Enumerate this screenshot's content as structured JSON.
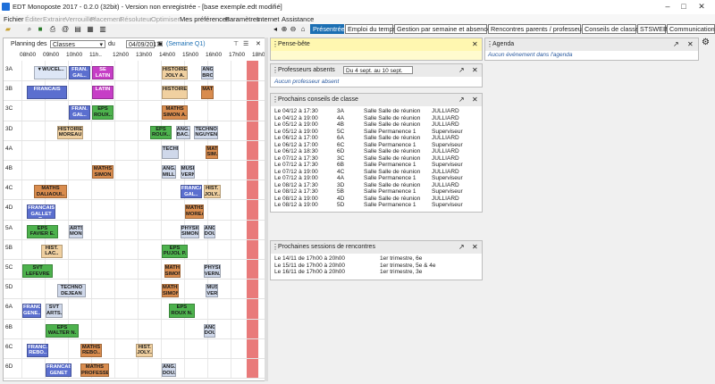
{
  "window": {
    "title": "EDT Monoposte 2017 - 0.2.0 (32bit) - Version non enregistrée - [base exemple.edt modifié]",
    "controls": [
      "–",
      "□",
      "✕"
    ]
  },
  "menu": [
    {
      "label": "Fichier",
      "dim": false
    },
    {
      "label": "Éditer",
      "dim": true
    },
    {
      "label": "Extraire",
      "dim": true
    },
    {
      "label": "Verrouiller",
      "dim": true
    },
    {
      "label": "Placement",
      "dim": true
    },
    {
      "label": "Résoluteur",
      "dim": true
    },
    {
      "label": "Optimiser",
      "dim": true
    },
    {
      "label": "Mes préférences",
      "dim": false
    },
    {
      "label": "Paramètres",
      "dim": false
    },
    {
      "label": "Internet",
      "dim": false
    },
    {
      "label": "Assistance",
      "dim": false
    }
  ],
  "tabs": [
    "Présentrée",
    "Emploi du temps",
    "Gestion par semaine et absences",
    "Rencontres parents / professeurs",
    "Conseils de classe",
    "STSWEB",
    "Communication"
  ],
  "planning": {
    "label_prefix": "Planning des",
    "select_value": "Classes",
    "du_label": "du",
    "date_value": "04/09/2017",
    "week_label": "(Semaine Q1)",
    "times": [
      "08h00",
      "09h00",
      "10h00",
      "11h..",
      "12h00",
      "13h00",
      "14h00",
      "15h00",
      "16h00",
      "17h00",
      "18h00"
    ],
    "rows": [
      "3A",
      "3B",
      "3C",
      "3D",
      "4A",
      "4B",
      "4C",
      "4D",
      "5A",
      "5B",
      "5C",
      "5D",
      "6A",
      "6B",
      "6C",
      "6D"
    ]
  },
  "schedule": [
    {
      "row": 0,
      "col": 0.5,
      "w": 1.5,
      "text": "▼WUCEL..",
      "color": "#dde6f6"
    },
    {
      "row": 0,
      "col": 3,
      "w": 1,
      "text": "SE LATIN",
      "color": "#c63ec6"
    },
    {
      "row": 0,
      "col": 2,
      "w": 1,
      "text": "FRAN. GAL..",
      "color": "#5b6fcf"
    },
    {
      "row": 0,
      "col": 6,
      "w": 1.2,
      "text": "HISTOIRE JOLY A.",
      "color": "#f0d0a0"
    },
    {
      "row": 0,
      "col": 7.7,
      "w": 0.6,
      "text": "ANG. BRO..",
      "color": "#cfd8ea"
    },
    {
      "row": 1,
      "col": 0.2,
      "w": 1.8,
      "text": "FRANCAIS",
      "color": "#5b6fcf"
    },
    {
      "row": 1,
      "col": 3,
      "w": 1,
      "text": "LATIN",
      "color": "#c63ec6"
    },
    {
      "row": 1,
      "col": 6,
      "w": 1.2,
      "text": "HISTOIRE-..",
      "color": "#f0d0a0"
    },
    {
      "row": 1,
      "col": 7.7,
      "w": 0.6,
      "text": "MATHS",
      "color": "#d98c4e"
    },
    {
      "row": 2,
      "col": 2,
      "w": 1,
      "text": "FRAN. GAL..",
      "color": "#5b6fcf"
    },
    {
      "row": 2,
      "col": 3,
      "w": 1,
      "text": "EPS ROUX..",
      "color": "#4db24d"
    },
    {
      "row": 2,
      "col": 6,
      "w": 1.2,
      "text": "MATHS SIMON A.",
      "color": "#d98c4e"
    },
    {
      "row": 3,
      "col": 1.5,
      "w": 1.2,
      "text": "HISTOIRE MOREAU C.",
      "color": "#f0d0a0"
    },
    {
      "row": 3,
      "col": 5.5,
      "w": 1,
      "text": "EPS ROUX..",
      "color": "#4db24d"
    },
    {
      "row": 3,
      "col": 6.6,
      "w": 0.7,
      "text": "ANG. BAC..",
      "color": "#cfd8ea"
    },
    {
      "row": 3,
      "col": 7.4,
      "w": 1.1,
      "text": "TECHNO NGUYEN S.",
      "color": "#cfd8ea"
    },
    {
      "row": 4,
      "col": 6,
      "w": 0.8,
      "text": "TECHNO",
      "color": "#cfd8ea"
    },
    {
      "row": 4,
      "col": 7.9,
      "w": 0.6,
      "text": "MATHS SIM..",
      "color": "#d98c4e"
    },
    {
      "row": 5,
      "col": 3,
      "w": 1,
      "text": "MATHS SIMON A.",
      "color": "#d98c4e"
    },
    {
      "row": 5,
      "col": 6,
      "w": 0.7,
      "text": "ANG. MILL..",
      "color": "#cfd8ea"
    },
    {
      "row": 5,
      "col": 6.8,
      "w": 0.7,
      "text": "MUSI.. VERN..",
      "color": "#cfd8ea"
    },
    {
      "row": 6,
      "col": 0.5,
      "w": 1.5,
      "text": "MATHS DALIAOUI..",
      "color": "#d98c4e"
    },
    {
      "row": 6,
      "col": 6.8,
      "w": 1,
      "text": "FRANCAIS GAL..",
      "color": "#5b6fcf"
    },
    {
      "row": 6,
      "col": 7.8,
      "w": 0.8,
      "text": "HIST. JOLY..",
      "color": "#f0d0a0"
    },
    {
      "row": 7,
      "col": 0.2,
      "w": 1.3,
      "text": "FRANCAIS GALLET B.",
      "color": "#5b6fcf"
    },
    {
      "row": 7,
      "col": 7,
      "w": 0.9,
      "text": "MATHS MOREAU..",
      "color": "#d98c4e"
    },
    {
      "row": 8,
      "col": 0.2,
      "w": 1.4,
      "text": "EPS FAVIER E.",
      "color": "#4db24d"
    },
    {
      "row": 8,
      "col": 2,
      "w": 0.7,
      "text": "ARTS. MONI..",
      "color": "#cfd8ea"
    },
    {
      "row": 8,
      "col": 6.8,
      "w": 0.9,
      "text": "PHYSIQUE.. SIMON T.",
      "color": "#cfd8ea"
    },
    {
      "row": 8,
      "col": 7.8,
      "w": 0.6,
      "text": "ANG. DOU..",
      "color": "#cfd8ea"
    },
    {
      "row": 9,
      "col": 0.8,
      "w": 1,
      "text": "HIST. LAC..",
      "color": "#f0d0a0"
    },
    {
      "row": 9,
      "col": 6,
      "w": 1.2,
      "text": "EPS PUJOL P.",
      "color": "#4db24d"
    },
    {
      "row": 10,
      "col": 0,
      "w": 1.4,
      "text": "SVT LEFEVRE A.",
      "color": "#4db24d"
    },
    {
      "row": 10,
      "col": 6.1,
      "w": 0.8,
      "text": "MATHS SIMON A.",
      "color": "#d98c4e"
    },
    {
      "row": 10,
      "col": 7.8,
      "w": 0.8,
      "text": "PHYSIQUE VERN..",
      "color": "#cfd8ea"
    },
    {
      "row": 11,
      "col": 1.5,
      "w": 1.3,
      "text": "TECHNO DEJEAN Y.",
      "color": "#cfd8ea"
    },
    {
      "row": 11,
      "col": 6,
      "w": 0.8,
      "text": "MATHS SIMON A.",
      "color": "#d98c4e"
    },
    {
      "row": 11,
      "col": 7.9,
      "w": 0.6,
      "text": "MUSI. VERN..",
      "color": "#cfd8ea"
    },
    {
      "row": 12,
      "col": 0,
      "w": 0.9,
      "text": "FRANC. GENE..",
      "color": "#5b6fcf"
    },
    {
      "row": 12,
      "col": 1,
      "w": 0.8,
      "text": "SVT ARTS..",
      "color": "#cfd8ea"
    },
    {
      "row": 12,
      "col": 6.3,
      "w": 1.2,
      "text": "EPS ROUX N.",
      "color": "#4db24d"
    },
    {
      "row": 13,
      "col": 1,
      "w": 1.5,
      "text": "EPS WALTER N.",
      "color": "#4db24d"
    },
    {
      "row": 13,
      "col": 7.8,
      "w": 0.6,
      "text": "ANG. DOU..",
      "color": "#cfd8ea"
    },
    {
      "row": 14,
      "col": 0.2,
      "w": 1,
      "text": "FRANC. REBO..",
      "color": "#5b6fcf"
    },
    {
      "row": 14,
      "col": 2.5,
      "w": 1,
      "text": "MATHS REBO..",
      "color": "#d98c4e"
    },
    {
      "row": 14,
      "col": 4.9,
      "w": 0.8,
      "text": "HIST. JOLY..",
      "color": "#f0d0a0"
    },
    {
      "row": 15,
      "col": 1,
      "w": 1.2,
      "text": "FRANCAIS GENET M.",
      "color": "#5b6fcf"
    },
    {
      "row": 15,
      "col": 2.5,
      "w": 1.3,
      "text": "MATHS PROFESSE..",
      "color": "#d98c4e"
    },
    {
      "row": 15,
      "col": 6,
      "w": 0.7,
      "text": "ANG. DOU..",
      "color": "#cfd8ea"
    }
  ],
  "pensebete": {
    "title": "Pense-bête"
  },
  "absents": {
    "title": "Professeurs absents",
    "range": "Du 4 sept. au 10 sept.",
    "empty": "Aucun professeur absent"
  },
  "conseils": {
    "title": "Prochains conseils de classe",
    "rows": [
      [
        "Le 04/12 à 17:30",
        "3A",
        "Salle Salle de réunion",
        "JULLIARD"
      ],
      [
        "Le 04/12 à 19:00",
        "4A",
        "Salle Salle de réunion",
        "JULLIARD"
      ],
      [
        "Le 05/12 à 19:00",
        "4B",
        "Salle Salle de réunion",
        "JULLIARD"
      ],
      [
        "Le 05/12 à 19:00",
        "5C",
        "Salle Permanence 1",
        "Superviseur"
      ],
      [
        "Le 06/12 à 17:00",
        "6A",
        "Salle Salle de réunion",
        "JULLIARD"
      ],
      [
        "Le 06/12 à 17:00",
        "6C",
        "Salle Permanence 1",
        "Superviseur"
      ],
      [
        "Le 06/12 à 18:30",
        "6D",
        "Salle Salle de réunion",
        "JULLIARD"
      ],
      [
        "Le 07/12 à 17:30",
        "3C",
        "Salle Salle de réunion",
        "JULLIARD"
      ],
      [
        "Le 07/12 à 17:30",
        "6B",
        "Salle Permanence 1",
        "Superviseur"
      ],
      [
        "Le 07/12 à 19:00",
        "4C",
        "Salle Salle de réunion",
        "JULLIARD"
      ],
      [
        "Le 07/12 à 19:00",
        "4A",
        "Salle Permanence 1",
        "Superviseur"
      ],
      [
        "Le 08/12 à 17:30",
        "3D",
        "Salle Salle de réunion",
        "JULLIARD"
      ],
      [
        "Le 08/12 à 17:30",
        "5B",
        "Salle Permanence 1",
        "Superviseur"
      ],
      [
        "Le 08/12 à 19:00",
        "4D",
        "Salle Salle de réunion",
        "JULLIARD"
      ],
      [
        "Le 08/12 à 19:00",
        "5D",
        "Salle Permanence 1",
        "Superviseur"
      ]
    ]
  },
  "rencontres": {
    "title": "Prochaines sessions de rencontres",
    "rows": [
      [
        "Le 14/11 de 17h00 à 20h00",
        "1er trimestre, 6e"
      ],
      [
        "Le 15/11 de 17h00 à 20h00",
        "1er trimestre, 5e & 4e"
      ],
      [
        "Le 16/11 de 17h00 à 20h00",
        "1er trimestre, 3e"
      ]
    ]
  },
  "agenda": {
    "title": "Agenda",
    "empty": "Aucun événement dans l'agenda"
  }
}
